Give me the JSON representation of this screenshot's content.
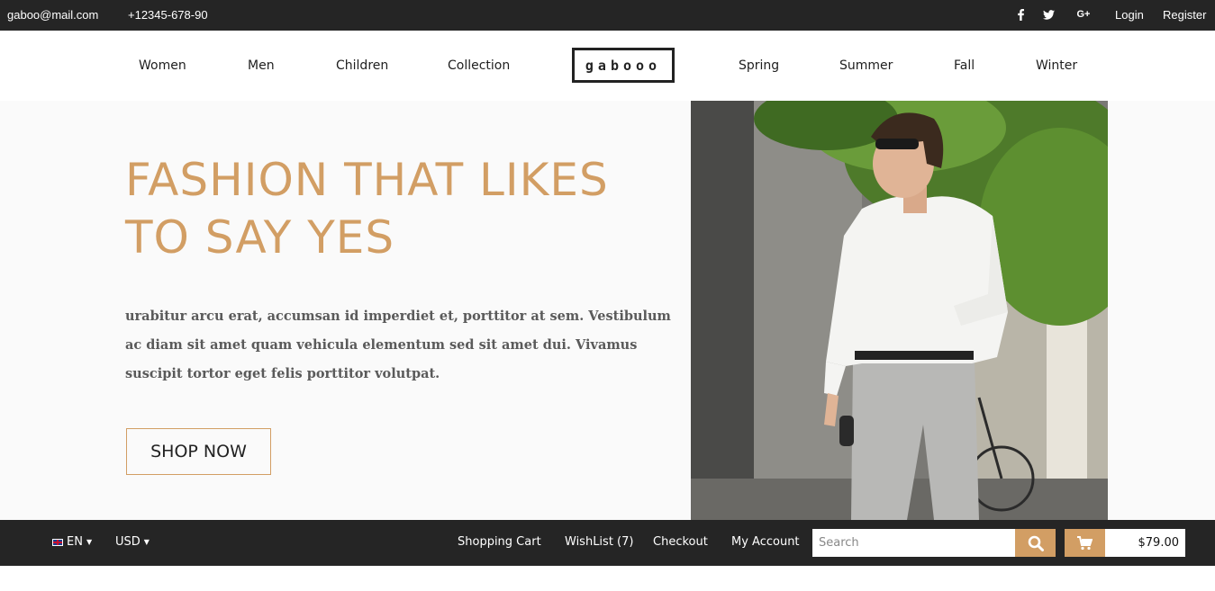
{
  "topbar": {
    "email": "gaboo@mail.com",
    "phone": "+12345-678-90",
    "social": [
      "f",
      "🐦",
      "G+"
    ],
    "login": "Login",
    "register": "Register"
  },
  "nav": {
    "left": [
      "Women",
      "Men",
      "Children",
      "Collection"
    ],
    "logo": "gabooo",
    "right": [
      "Spring",
      "Summer",
      "Fall",
      "Winter"
    ]
  },
  "hero": {
    "headline": "FASHION THAT LIKES TO SAY YES",
    "body": "urabitur arcu erat, accumsan id imperdiet et, porttitor at sem. Vestibulum ac diam sit amet quam vehicula elementum sed sit amet dui. Vivamus suscipit tortor eget felis porttitor volutpat.",
    "cta": "SHOP NOW"
  },
  "bottombar": {
    "language": "EN",
    "currency": "USD",
    "links": [
      "Shopping Cart",
      "WishList (7)",
      "Checkout",
      "My Account"
    ],
    "search_placeholder": "Search",
    "cart_total": "$79.00"
  },
  "colors": {
    "accent": "#d29e64",
    "dark": "#252525",
    "hero_bg": "#fafafa"
  },
  "icons": {
    "search": "search-icon",
    "cart": "cart-icon",
    "facebook": "facebook-icon",
    "twitter": "twitter-icon",
    "googleplus": "googleplus-icon",
    "caret": "caret-down-icon",
    "flag": "flag-uk-icon"
  }
}
